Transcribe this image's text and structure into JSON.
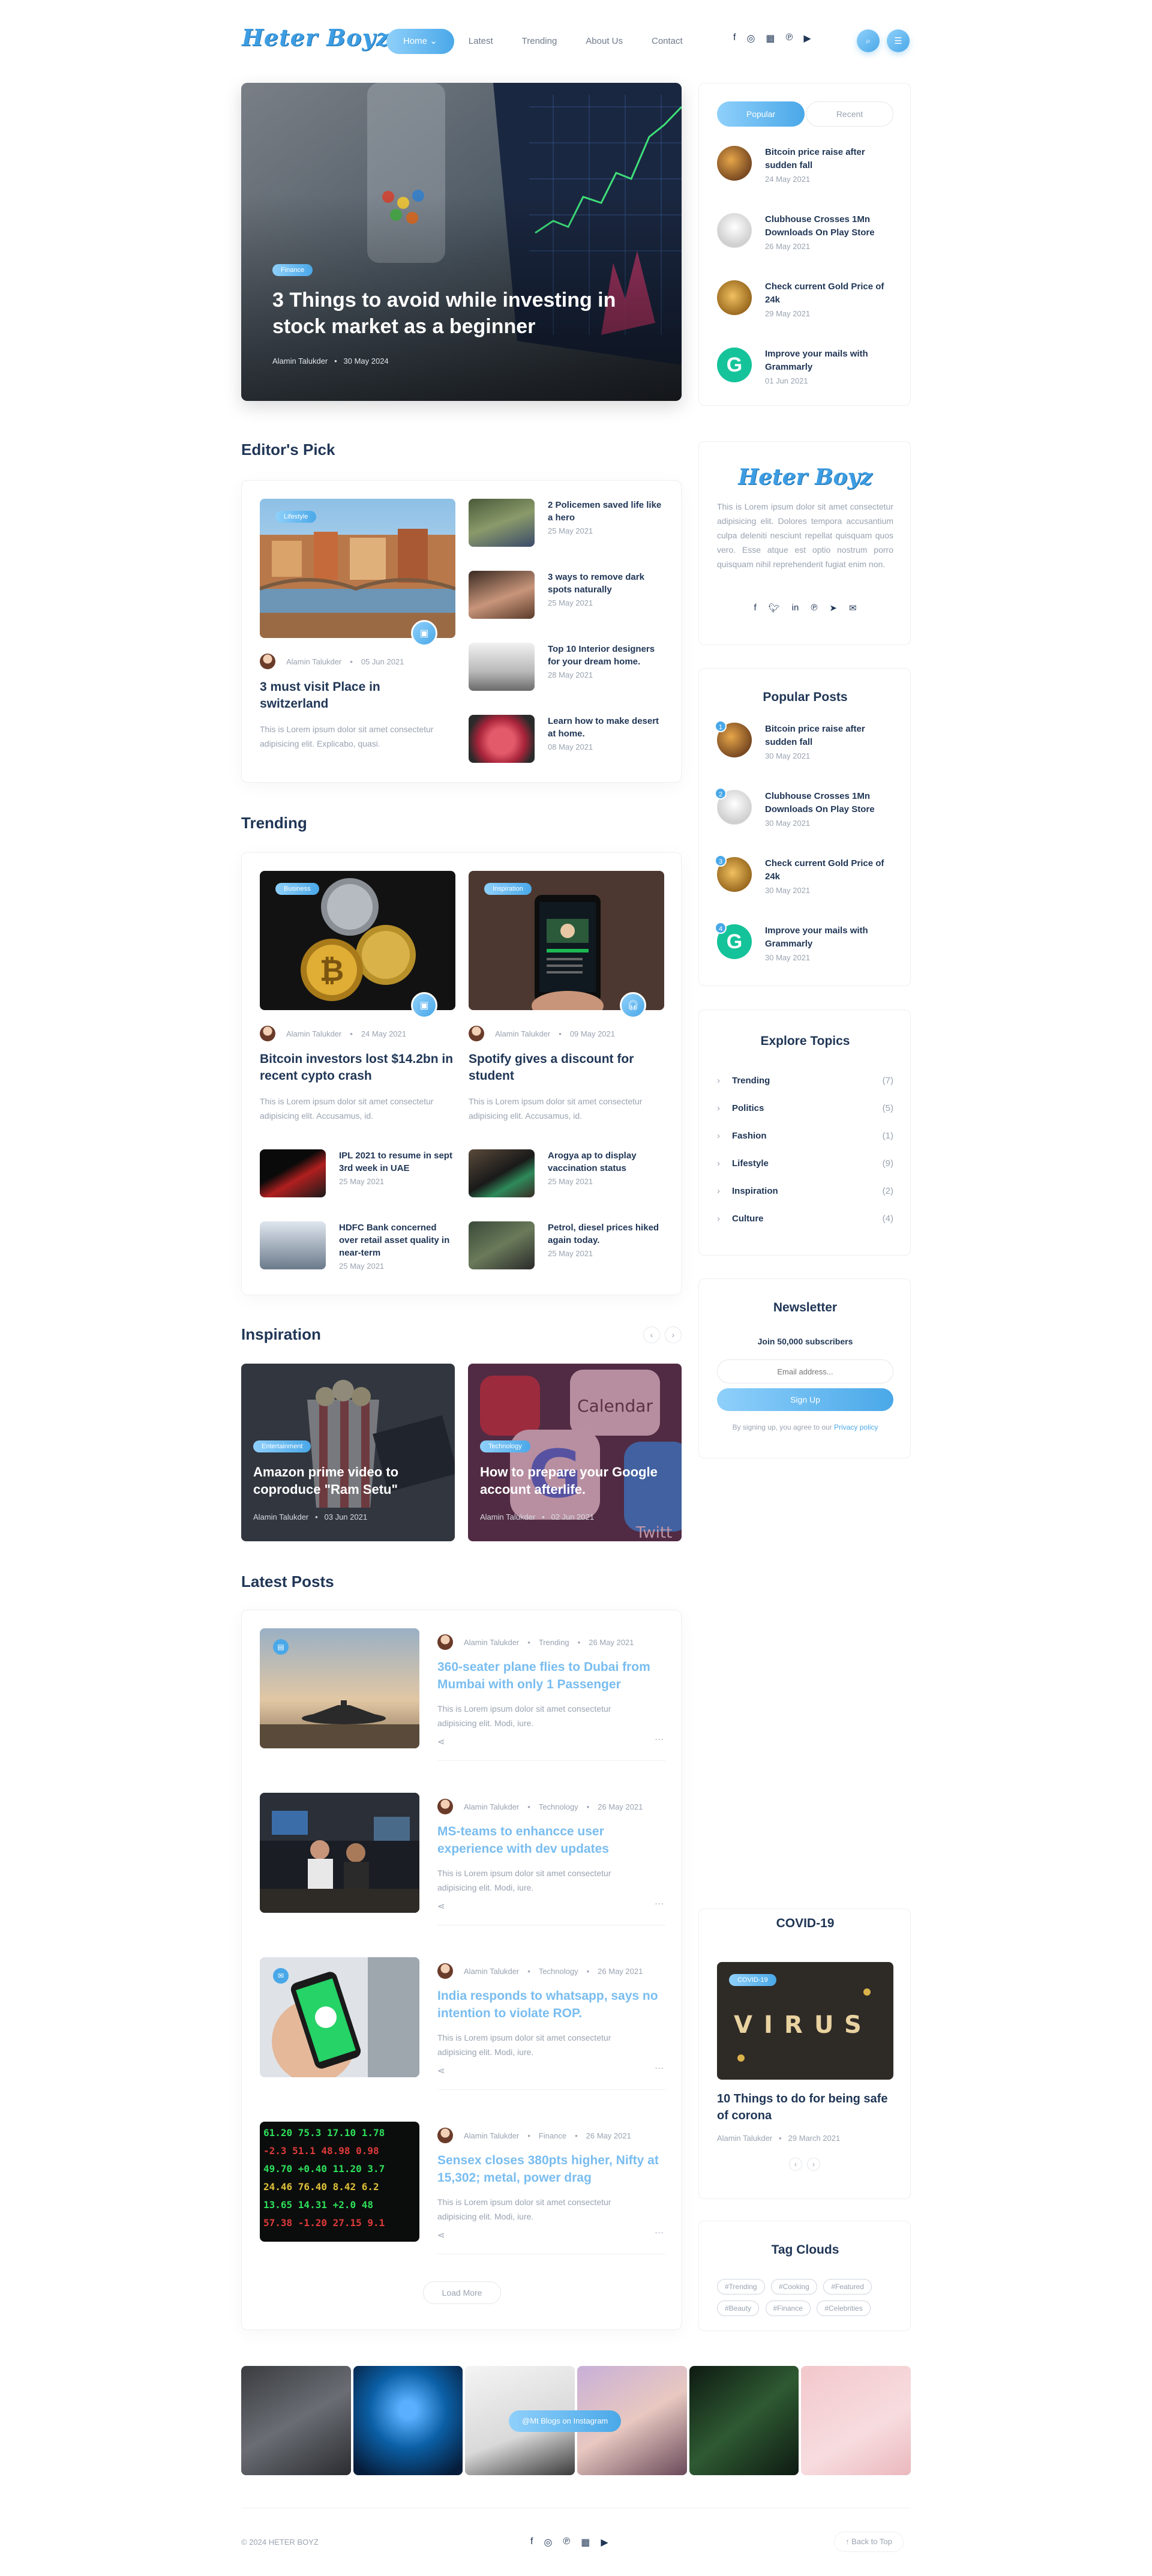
{
  "brand": {
    "logo": "Heter Boyz"
  },
  "nav": {
    "items": [
      "Home",
      "Latest",
      "Trending",
      "About Us",
      "Contact"
    ],
    "active_chevron": "⌄"
  },
  "hero": {
    "badge": "Finance",
    "title": "3 Things to avoid while investing in stock market as a beginner",
    "author": "Alamin Talukder",
    "date": "30 May 2024"
  },
  "tabs": {
    "popular": "Popular",
    "recent": "Recent"
  },
  "sidebar_popular": [
    {
      "title": "Bitcoin price raise after sudden fall",
      "date": "24 May 2021"
    },
    {
      "title": "Clubhouse Crosses 1Mn Downloads On Play Store",
      "date": "26 May 2021"
    },
    {
      "title": "Check current Gold Price of 24k",
      "date": "29 May 2021"
    },
    {
      "title": "Improve your mails with Grammarly",
      "date": "01 Jun 2021"
    }
  ],
  "about": {
    "logo": "Heter Boyz",
    "text": "This is Lorem ipsum dolor sit amet consectetur adipisicing elit. Dolores tempora accusantium culpa deleniti nesciunt repellat quisquam quos vero. Esse atque est optio nostrum porro quisquam nihil reprehenderit fugiat enim non."
  },
  "editors_pick": {
    "title": "Editor's Pick",
    "main": {
      "badge": "Lifestyle",
      "author": "Alamin Talukder",
      "date": "05 Jun 2021",
      "title": "3 must visit Place in switzerland",
      "excerpt": "This is Lorem ipsum dolor sit amet consectetur adipisicing elit. Explicabo, quasi."
    },
    "list": [
      {
        "title": "2 Policemen saved life like a hero",
        "date": "25 May 2021"
      },
      {
        "title": "3 ways to remove dark spots naturally",
        "date": "25 May 2021"
      },
      {
        "title": "Top 10 Interior designers for your dream home.",
        "date": "28 May 2021"
      },
      {
        "title": "Learn how to make desert at home.",
        "date": "08 May 2021"
      }
    ]
  },
  "popular_posts": {
    "title": "Popular Posts",
    "items": [
      {
        "num": "1",
        "title": "Bitcoin price raise after sudden fall",
        "date": "30 May 2021"
      },
      {
        "num": "2",
        "title": "Clubhouse Crosses 1Mn Downloads On Play Store",
        "date": "30 May 2021"
      },
      {
        "num": "3",
        "title": "Check current Gold Price of 24k",
        "date": "30 May 2021"
      },
      {
        "num": "4",
        "title": "Improve your mails with Grammarly",
        "date": "30 May 2021"
      }
    ]
  },
  "trending": {
    "title": "Trending",
    "main": [
      {
        "badge": "Business",
        "author": "Alamin Talukder",
        "date": "24 May 2021",
        "title": "Bitcoin investors lost $14.2bn in recent cypto crash",
        "excerpt": "This is Lorem ipsum dolor sit amet consectetur adipisicing elit. Accusamus, id."
      },
      {
        "badge": "Inspiration",
        "author": "Alamin Talukder",
        "date": "09 May 2021",
        "title": "Spotify gives a discount for student",
        "excerpt": "This is Lorem ipsum dolor sit amet consectetur adipisicing elit. Accusamus, id."
      }
    ],
    "small": [
      {
        "title": "IPL 2021 to resume in sept 3rd week in UAE",
        "date": "25 May 2021"
      },
      {
        "title": "Arogya ap to display vaccination status",
        "date": "25 May 2021"
      },
      {
        "title": "HDFC Bank concerned over retail asset quality in near-term",
        "date": "25 May 2021"
      },
      {
        "title": "Petrol, diesel prices hiked again today.",
        "date": "25 May 2021"
      }
    ]
  },
  "explore": {
    "title": "Explore Topics",
    "items": [
      {
        "name": "Trending",
        "count": "(7)"
      },
      {
        "name": "Politics",
        "count": "(5)"
      },
      {
        "name": "Fashion",
        "count": "(1)"
      },
      {
        "name": "Lifestyle",
        "count": "(9)"
      },
      {
        "name": "Inspiration",
        "count": "(2)"
      },
      {
        "name": "Culture",
        "count": "(4)"
      }
    ]
  },
  "newsletter": {
    "title": "Newsletter",
    "subtitle": "Join 50,000 subscribers",
    "placeholder": "Email address...",
    "button": "Sign Up",
    "note": "By signing up, you agree to our",
    "privacy": "Privacy policy"
  },
  "inspiration": {
    "title": "Inspiration",
    "items": [
      {
        "badge": "Entertainment",
        "title": "Amazon prime video to coproduce \"Ram Setu\"",
        "author": "Alamin Talukder",
        "date": "03 Jun 2021"
      },
      {
        "badge": "Technology",
        "title": "How to prepare your Google account afterlife.",
        "author": "Alamin Talukder",
        "date": "02 Jun 2021"
      }
    ]
  },
  "latest": {
    "title": "Latest Posts",
    "load_more": "Load More",
    "items": [
      {
        "author": "Alamin Talukder",
        "cat": "Trending",
        "date": "26 May 2021",
        "title": "360-seater plane flies to Dubai from Mumbai with only 1 Passenger",
        "excerpt": "This is Lorem ipsum dolor sit amet consectetur adipisicing elit. Modi, iure."
      },
      {
        "author": "Alamin Talukder",
        "cat": "Technology",
        "date": "26 May 2021",
        "title": "MS-teams to enhancce user experience with dev updates",
        "excerpt": "This is Lorem ipsum dolor sit amet consectetur adipisicing elit. Modi, iure."
      },
      {
        "author": "Alamin Talukder",
        "cat": "Technology",
        "date": "26 May 2021",
        "title": "India responds to whatsapp, says no intention to violate ROP.",
        "excerpt": "This is Lorem ipsum dolor sit amet consectetur adipisicing elit. Modi, iure."
      },
      {
        "author": "Alamin Talukder",
        "cat": "Finance",
        "date": "26 May 2021",
        "title": "Sensex closes 380pts higher, Nifty at 15,302; metal, power drag",
        "excerpt": "This is Lorem ipsum dolor sit amet consectetur adipisicing elit. Modi, iure."
      }
    ]
  },
  "covid": {
    "heading": "COVID-19",
    "badge": "COVID-19",
    "title": "10 Things to do for being safe of corona",
    "author": "Alamin Talukder",
    "date": "29 March 2021"
  },
  "tagclouds": {
    "title": "Tag Clouds",
    "tags": [
      "#Trending",
      "#Cooking",
      "#Featured",
      "#Beauty",
      "#Finance",
      "#Celebrities"
    ]
  },
  "instagram": {
    "label": "@Mt Blogs on Instagram"
  },
  "footer": {
    "copyright": "© 2024 HETER BOYZ",
    "back_to_top": "Back to Top"
  },
  "colors": {
    "accent": "#4aa8e8",
    "accent_light": "#8fd0fb",
    "heading": "#203656",
    "muted": "#9aa3b1"
  }
}
